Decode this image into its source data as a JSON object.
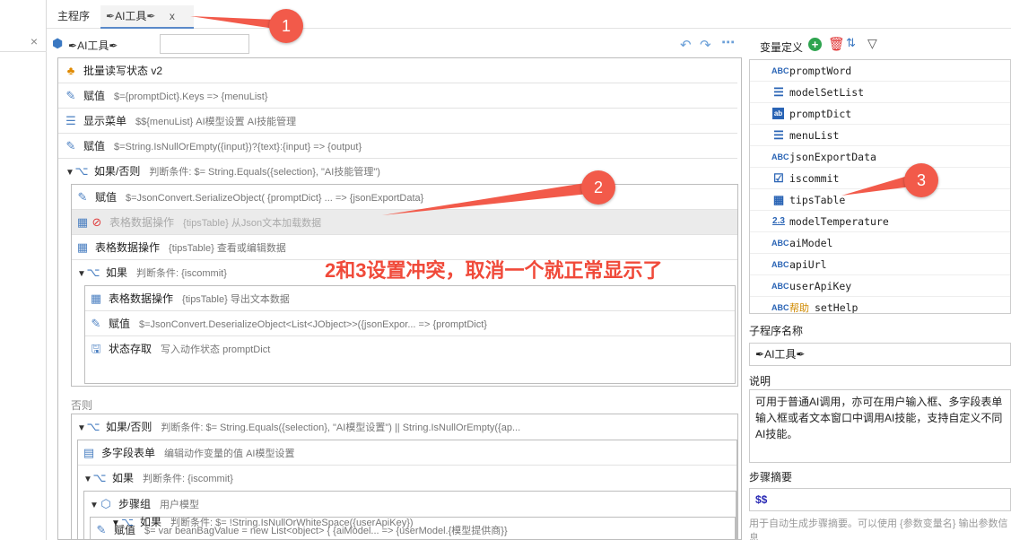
{
  "tabs": {
    "main_label": "主程序",
    "ai_label": "AI工具",
    "close": "x"
  },
  "left": {
    "close": "×"
  },
  "toolbar": {
    "title": "AI工具"
  },
  "steps": [
    {
      "name": "批量读写状态 v2",
      "desc": ""
    },
    {
      "name": "赋值",
      "desc": "$={promptDict}.Keys => {menuList}"
    },
    {
      "name": "显示菜单",
      "desc": "$${menuList}  AI模型设置  AI技能管理"
    },
    {
      "name": "赋值",
      "desc": "$=String.IsNullOrEmpty({input})?{text}:{input} => {output}"
    },
    {
      "name": "如果/否则",
      "desc": "判断条件: $= String.Equals({selection}, \"AI技能管理\")"
    },
    {
      "name": "赋值",
      "desc": "$=JsonConvert.SerializeObject(                  {promptDict}         ... => {jsonExportData}"
    },
    {
      "name": "表格数据操作",
      "desc": "{tipsTable} 从Json文本加载数据"
    },
    {
      "name": "表格数据操作",
      "desc": "{tipsTable} 查看或编辑数据"
    },
    {
      "name": "如果",
      "desc": "判断条件: {iscommit}"
    },
    {
      "name": "表格数据操作",
      "desc": "{tipsTable} 导出文本数据"
    },
    {
      "name": "赋值",
      "desc": "$=JsonConvert.DeserializeObject<List<JObject>>({jsonExpor... => {promptDict}"
    },
    {
      "name": "状态存取",
      "desc": "写入动作状态   promptDict"
    },
    {
      "name": "如果/否则",
      "desc": "判断条件: $= String.Equals({selection}, \"AI模型设置\") || String.IsNullOrEmpty({ap..."
    },
    {
      "name": "多字段表单",
      "desc": "编辑动作变量的值 AI模型设置"
    },
    {
      "name": "如果",
      "desc": "判断条件: {iscommit}"
    },
    {
      "name": "步骤组",
      "desc": "用户模型"
    },
    {
      "name": "赋值",
      "desc": "$=  var beanBagValue = new List<object>   {       {aiModel... => {userModel.{模型提供商}}"
    },
    {
      "name": "如果",
      "desc": "判断条件: $= !String.IsNullOrWhiteSpace({userApiKey})"
    }
  ],
  "else_label": "否则",
  "annotations": {
    "badge1": "1",
    "badge2": "2",
    "badge3": "3",
    "text": "2和3设置冲突，取消一个就正常显示了"
  },
  "right": {
    "var_title": "变量定义",
    "variables": [
      {
        "type": "ABC",
        "name": "promptWord"
      },
      {
        "type": "list",
        "name": "modelSetList"
      },
      {
        "type": "dict",
        "name": "promptDict"
      },
      {
        "type": "list",
        "name": "menuList"
      },
      {
        "type": "ABC",
        "name": "jsonExportData"
      },
      {
        "type": "check",
        "name": "iscommit"
      },
      {
        "type": "table",
        "name": "tipsTable"
      },
      {
        "type": "2.3",
        "name": "modelTemperature"
      },
      {
        "type": "ABC",
        "name": "aiModel"
      },
      {
        "type": "ABC",
        "name": "apiUrl"
      },
      {
        "type": "ABC",
        "name": "userApiKey"
      },
      {
        "type": "ABC",
        "name": "setHelp",
        "help": "帮助"
      }
    ],
    "sub_name_label": "子程序名称",
    "sub_name_value": "AI工具",
    "desc_label": "说明",
    "desc_value": "可用于普通AI调用，亦可在用户输入框、多字段表单输入框或者文本窗口中调用AI技能，支持自定义不同AI技能。",
    "summary_label": "步骤摘要",
    "summary_value": "$$",
    "summary_hint": "用于自动生成步骤摘要。可以使用 {参数变量名} 输出参数信息"
  },
  "colors": {
    "accent": "#5a89c9",
    "annotation": "#f25a4a"
  }
}
